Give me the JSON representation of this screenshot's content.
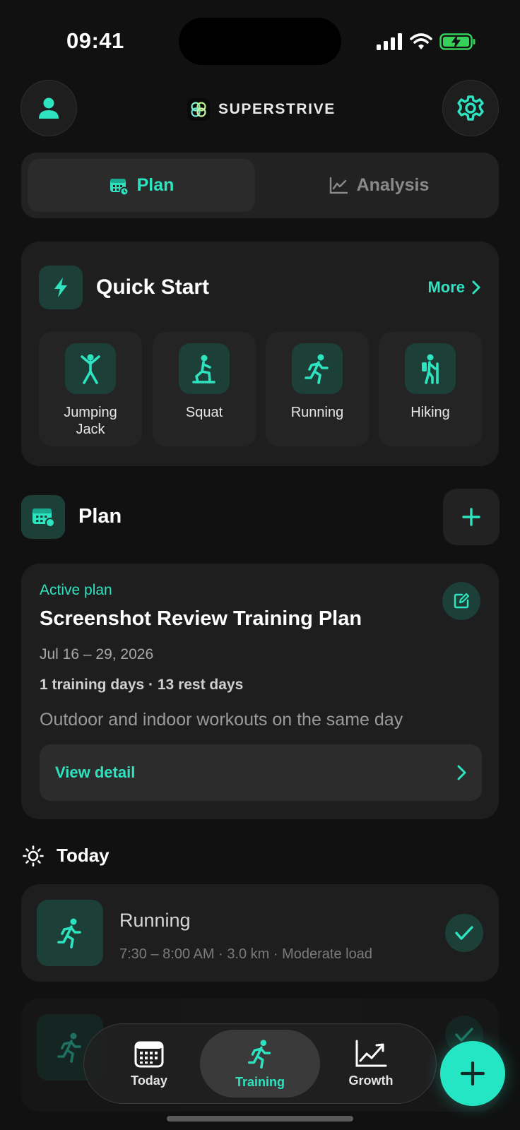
{
  "status_bar": {
    "time": "09:41"
  },
  "header": {
    "brand": "SUPERSTRIVE"
  },
  "segmented": {
    "plan_label": "Plan",
    "analysis_label": "Analysis"
  },
  "quick_start": {
    "title": "Quick Start",
    "more_label": "More",
    "items": [
      {
        "label": "Jumping Jack",
        "icon": "jumping-jack-icon"
      },
      {
        "label": "Squat",
        "icon": "squat-icon"
      },
      {
        "label": "Running",
        "icon": "running-icon"
      },
      {
        "label": "Hiking",
        "icon": "hiking-icon"
      }
    ]
  },
  "plan_section": {
    "title": "Plan"
  },
  "active_plan": {
    "tag": "Active plan",
    "title": "Screenshot Review Training Plan",
    "dates": "Jul 16 – 29, 2026",
    "stats": "1 training days · 13 rest days",
    "description": "Outdoor and indoor workouts on the same day",
    "view_detail_label": "View detail"
  },
  "today": {
    "title": "Today",
    "activities": [
      {
        "title": "Running",
        "meta": "7:30 – 8:00 AM · 3.0 km · Moderate load",
        "completed": true
      }
    ]
  },
  "tabbar": {
    "today_label": "Today",
    "training_label": "Training",
    "growth_label": "Growth",
    "active": "Training"
  },
  "colors": {
    "accent": "#2EE3C0",
    "background": "#111111",
    "card": "#1E1E1E",
    "icon_tile": "#1C3F37"
  }
}
